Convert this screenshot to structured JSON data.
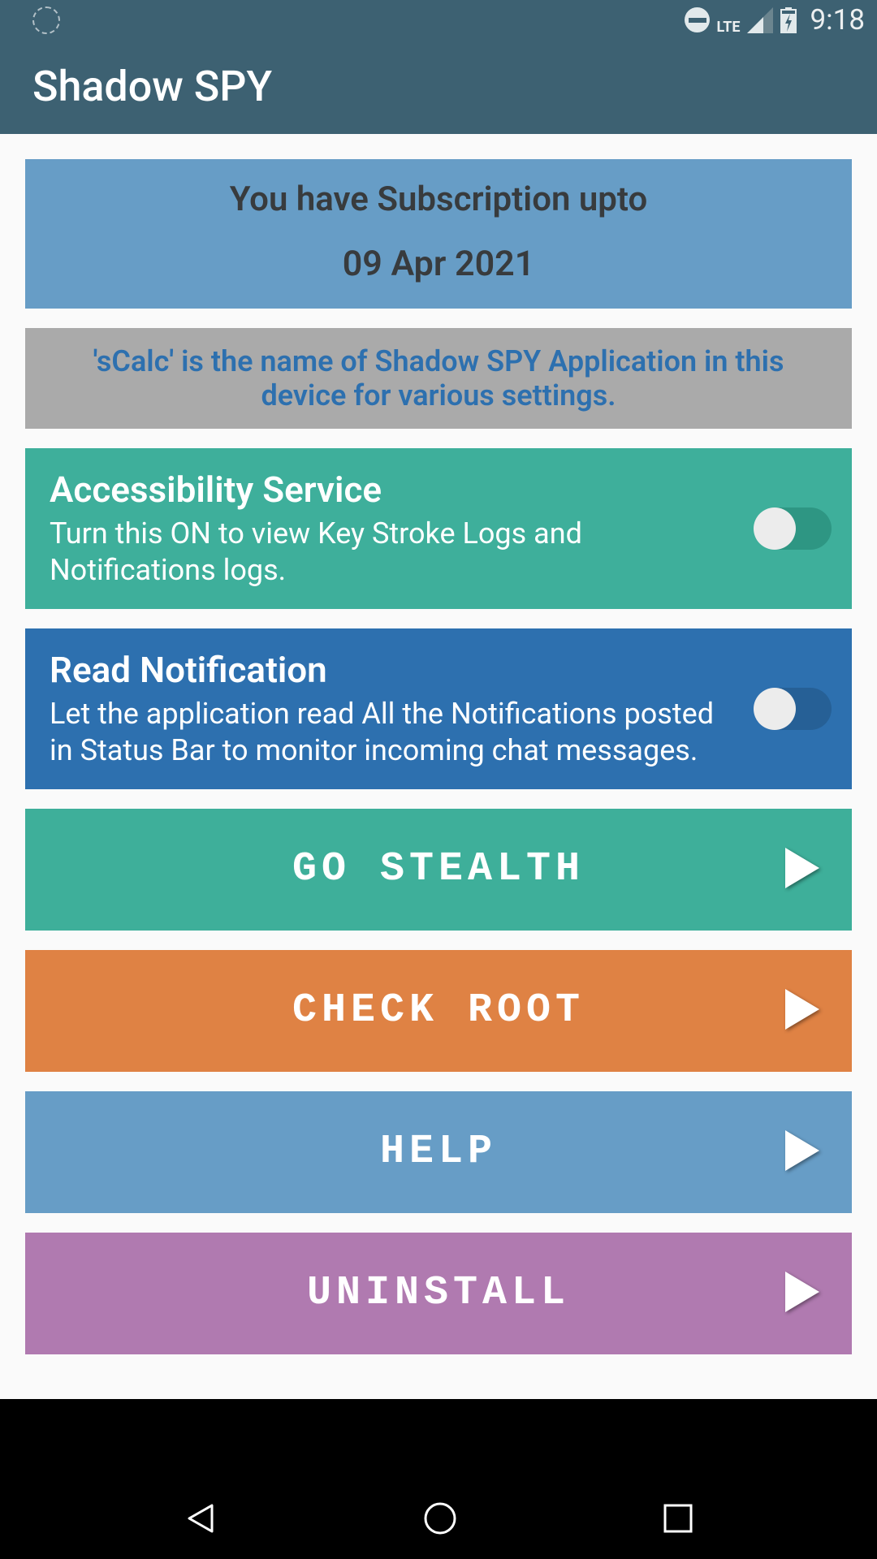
{
  "statusBar": {
    "networkType": "LTE",
    "time": "9:18"
  },
  "appBar": {
    "title": "Shadow SPY"
  },
  "subscription": {
    "title": "You have Subscription upto",
    "date": "09 Apr 2021"
  },
  "infoCard": {
    "text": "'sCalc' is the name of Shadow SPY Application in this device for various settings."
  },
  "settings": {
    "accessibility": {
      "title": "Accessibility Service",
      "description": "Turn this ON to view Key Stroke Logs and Notifications logs.",
      "enabled": false
    },
    "readNotification": {
      "title": "Read Notification",
      "description": "Let the application read All the Notifications posted in Status Bar to monitor incoming chat messages.",
      "enabled": false
    }
  },
  "actions": {
    "goStealth": "GO STEALTH",
    "checkRoot": "CHECK ROOT",
    "help": "HELP",
    "uninstall": "UNINSTALL"
  }
}
